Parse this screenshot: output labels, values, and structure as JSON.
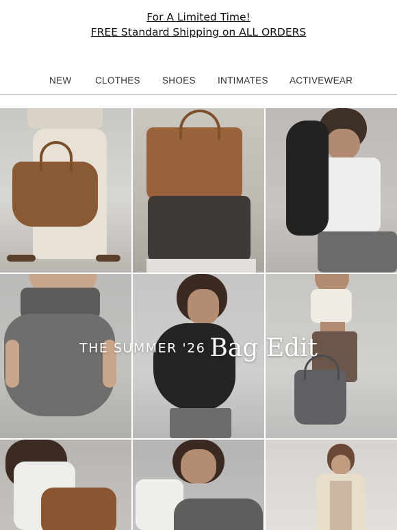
{
  "promo": {
    "line1": "For A Limited Time!",
    "line2": "FREE Standard Shipping on ALL ORDERS"
  },
  "nav": {
    "items": [
      {
        "label": "NEW"
      },
      {
        "label": "CLOTHES"
      },
      {
        "label": "SHOES"
      },
      {
        "label": "INTIMATES"
      },
      {
        "label": "ACTIVEWEAR"
      }
    ]
  },
  "hero": {
    "headline_prefix": "THE SUMMER '26",
    "headline_script": "Bag Edit"
  },
  "colors": {
    "text": "#111111",
    "divider": "#d0d0d0",
    "brown_leather": "#8a5a34",
    "charcoal": "#3a3836",
    "gray_fabric": "#6e6d6b"
  }
}
